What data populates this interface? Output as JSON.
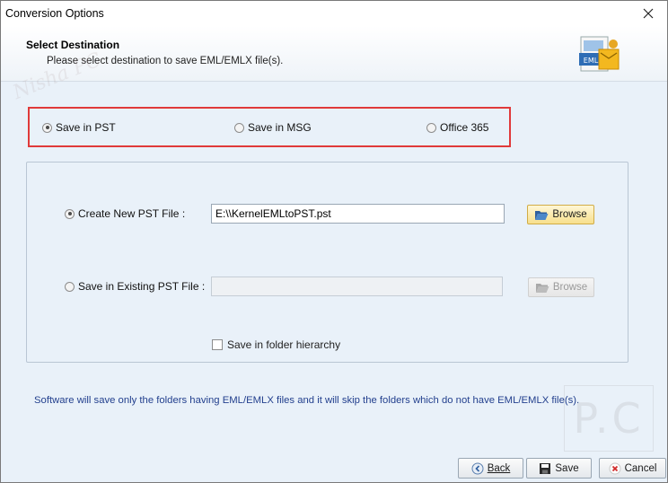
{
  "window": {
    "title": "Conversion Options"
  },
  "header": {
    "title": "Select Destination",
    "subtitle": "Please select destination to save EML/EMLX file(s).",
    "icon_label": "EML"
  },
  "destination": {
    "options": [
      {
        "label": "Save in PST",
        "selected": true
      },
      {
        "label": "Save in MSG",
        "selected": false
      },
      {
        "label": "Office 365",
        "selected": false
      }
    ]
  },
  "pst": {
    "create_new_label": "Create New PST File :",
    "create_new_selected": true,
    "create_new_path": "E:\\\\KernelEMLtoPST.pst",
    "browse_label": "Browse",
    "existing_label": "Save in Existing PST File :",
    "existing_selected": false,
    "existing_path": "",
    "browse_disabled_label": "Browse",
    "hierarchy_label": "Save in folder hierarchy",
    "hierarchy_checked": false
  },
  "note": "Software will save only the folders having EML/EMLX files and it will skip the folders which do not have EML/EMLX file(s).",
  "footer": {
    "back_label": "Back",
    "save_label": "Save",
    "cancel_label": "Cancel"
  },
  "colors": {
    "highlight_border": "#e03a3a",
    "panel_bg": "#e9f1f9",
    "note_text": "#23408e"
  }
}
